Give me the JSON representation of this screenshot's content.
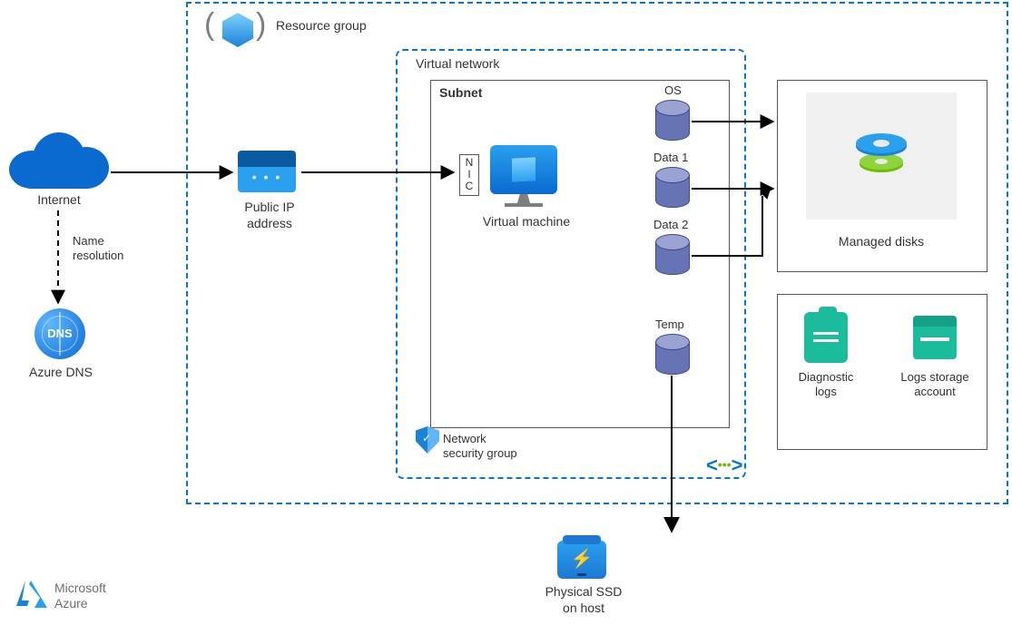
{
  "labels": {
    "resource_group": "Resource group",
    "virtual_network": "Virtual network",
    "subnet": "Subnet",
    "nic": "N\nI\nC",
    "virtual_machine": "Virtual machine",
    "internet": "Internet",
    "name_resolution": "Name\nresolution",
    "azure_dns": "Azure DNS",
    "dns_badge": "DNS",
    "public_ip": "Public IP\naddress",
    "network_sg": "Network\nsecurity group",
    "managed_disks": "Managed disks",
    "diag_logs": "Diagnostic\nlogs",
    "logs_storage": "Logs storage\naccount",
    "physical_ssd": "Physical SSD\non host",
    "azure_logo": "Microsoft\nAzure"
  },
  "disks": {
    "os": "OS",
    "data1": "Data 1",
    "data2": "Data 2",
    "temp": "Temp"
  }
}
